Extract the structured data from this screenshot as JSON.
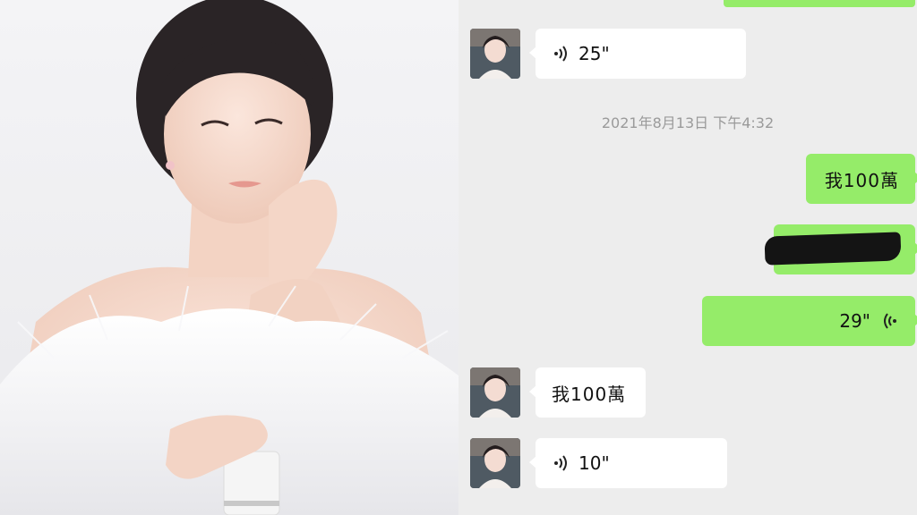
{
  "conversation": {
    "messages": [
      {
        "side": "in",
        "type": "voice",
        "duration": "25\""
      },
      {
        "side": "system",
        "type": "timestamp",
        "text": "2021年8月13日 下午4:32"
      },
      {
        "side": "out",
        "type": "text",
        "text": "我100萬"
      },
      {
        "side": "out",
        "type": "redacted"
      },
      {
        "side": "out",
        "type": "voice",
        "duration": "29\""
      },
      {
        "side": "in",
        "type": "text",
        "text": "我100萬"
      },
      {
        "side": "in",
        "type": "voice",
        "duration": "10\""
      }
    ]
  },
  "colors": {
    "chat_background": "#ededed",
    "outgoing_bubble": "#95ec69",
    "incoming_bubble": "#ffffff",
    "timestamp_text": "#9a9a9a"
  },
  "icons": {
    "voice_in": "voice-wave-icon",
    "voice_out": "voice-wave-icon"
  }
}
